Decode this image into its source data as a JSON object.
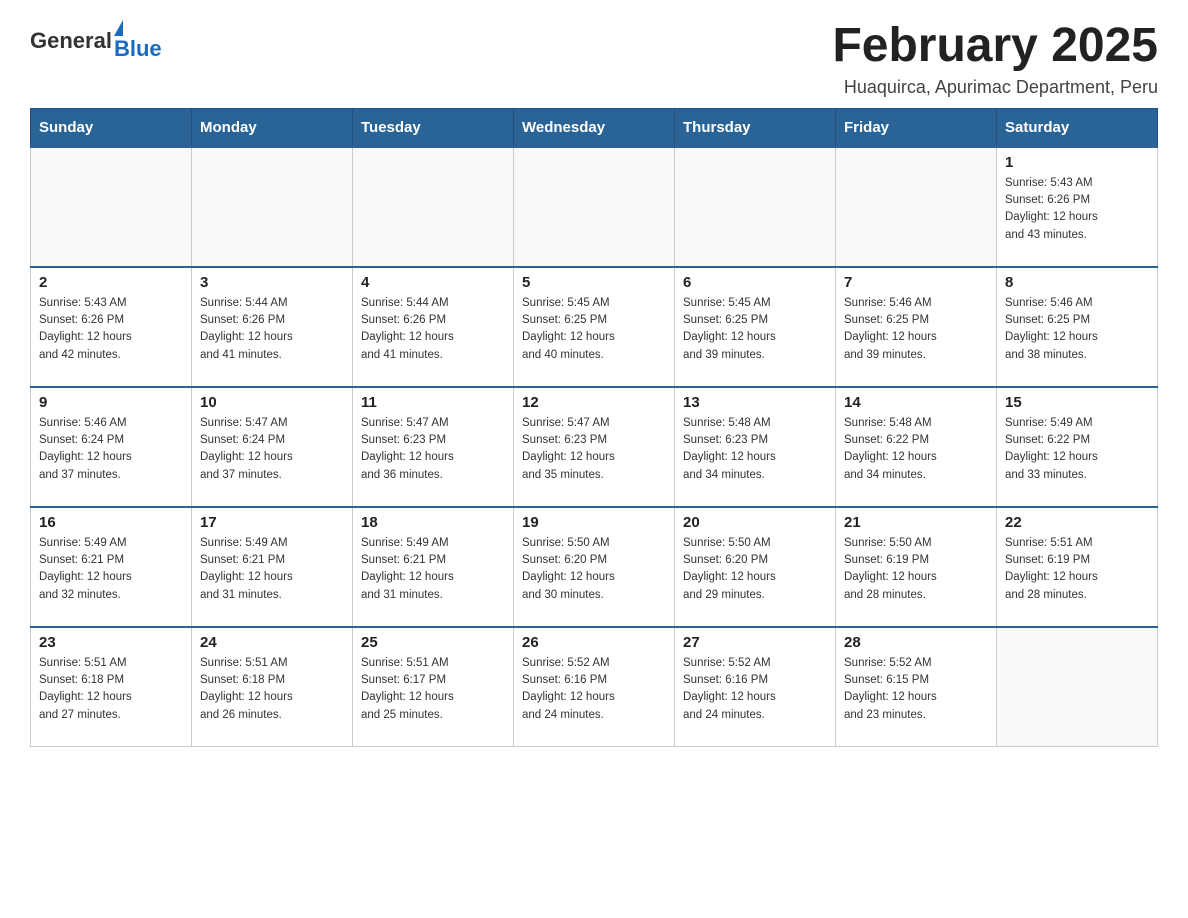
{
  "header": {
    "logo_general": "General",
    "logo_blue": "Blue",
    "month_title": "February 2025",
    "location": "Huaquirca, Apurimac Department, Peru"
  },
  "days_of_week": [
    "Sunday",
    "Monday",
    "Tuesday",
    "Wednesday",
    "Thursday",
    "Friday",
    "Saturday"
  ],
  "weeks": [
    [
      {
        "day": "",
        "info": ""
      },
      {
        "day": "",
        "info": ""
      },
      {
        "day": "",
        "info": ""
      },
      {
        "day": "",
        "info": ""
      },
      {
        "day": "",
        "info": ""
      },
      {
        "day": "",
        "info": ""
      },
      {
        "day": "1",
        "info": "Sunrise: 5:43 AM\nSunset: 6:26 PM\nDaylight: 12 hours\nand 43 minutes."
      }
    ],
    [
      {
        "day": "2",
        "info": "Sunrise: 5:43 AM\nSunset: 6:26 PM\nDaylight: 12 hours\nand 42 minutes."
      },
      {
        "day": "3",
        "info": "Sunrise: 5:44 AM\nSunset: 6:26 PM\nDaylight: 12 hours\nand 41 minutes."
      },
      {
        "day": "4",
        "info": "Sunrise: 5:44 AM\nSunset: 6:26 PM\nDaylight: 12 hours\nand 41 minutes."
      },
      {
        "day": "5",
        "info": "Sunrise: 5:45 AM\nSunset: 6:25 PM\nDaylight: 12 hours\nand 40 minutes."
      },
      {
        "day": "6",
        "info": "Sunrise: 5:45 AM\nSunset: 6:25 PM\nDaylight: 12 hours\nand 39 minutes."
      },
      {
        "day": "7",
        "info": "Sunrise: 5:46 AM\nSunset: 6:25 PM\nDaylight: 12 hours\nand 39 minutes."
      },
      {
        "day": "8",
        "info": "Sunrise: 5:46 AM\nSunset: 6:25 PM\nDaylight: 12 hours\nand 38 minutes."
      }
    ],
    [
      {
        "day": "9",
        "info": "Sunrise: 5:46 AM\nSunset: 6:24 PM\nDaylight: 12 hours\nand 37 minutes."
      },
      {
        "day": "10",
        "info": "Sunrise: 5:47 AM\nSunset: 6:24 PM\nDaylight: 12 hours\nand 37 minutes."
      },
      {
        "day": "11",
        "info": "Sunrise: 5:47 AM\nSunset: 6:23 PM\nDaylight: 12 hours\nand 36 minutes."
      },
      {
        "day": "12",
        "info": "Sunrise: 5:47 AM\nSunset: 6:23 PM\nDaylight: 12 hours\nand 35 minutes."
      },
      {
        "day": "13",
        "info": "Sunrise: 5:48 AM\nSunset: 6:23 PM\nDaylight: 12 hours\nand 34 minutes."
      },
      {
        "day": "14",
        "info": "Sunrise: 5:48 AM\nSunset: 6:22 PM\nDaylight: 12 hours\nand 34 minutes."
      },
      {
        "day": "15",
        "info": "Sunrise: 5:49 AM\nSunset: 6:22 PM\nDaylight: 12 hours\nand 33 minutes."
      }
    ],
    [
      {
        "day": "16",
        "info": "Sunrise: 5:49 AM\nSunset: 6:21 PM\nDaylight: 12 hours\nand 32 minutes."
      },
      {
        "day": "17",
        "info": "Sunrise: 5:49 AM\nSunset: 6:21 PM\nDaylight: 12 hours\nand 31 minutes."
      },
      {
        "day": "18",
        "info": "Sunrise: 5:49 AM\nSunset: 6:21 PM\nDaylight: 12 hours\nand 31 minutes."
      },
      {
        "day": "19",
        "info": "Sunrise: 5:50 AM\nSunset: 6:20 PM\nDaylight: 12 hours\nand 30 minutes."
      },
      {
        "day": "20",
        "info": "Sunrise: 5:50 AM\nSunset: 6:20 PM\nDaylight: 12 hours\nand 29 minutes."
      },
      {
        "day": "21",
        "info": "Sunrise: 5:50 AM\nSunset: 6:19 PM\nDaylight: 12 hours\nand 28 minutes."
      },
      {
        "day": "22",
        "info": "Sunrise: 5:51 AM\nSunset: 6:19 PM\nDaylight: 12 hours\nand 28 minutes."
      }
    ],
    [
      {
        "day": "23",
        "info": "Sunrise: 5:51 AM\nSunset: 6:18 PM\nDaylight: 12 hours\nand 27 minutes."
      },
      {
        "day": "24",
        "info": "Sunrise: 5:51 AM\nSunset: 6:18 PM\nDaylight: 12 hours\nand 26 minutes."
      },
      {
        "day": "25",
        "info": "Sunrise: 5:51 AM\nSunset: 6:17 PM\nDaylight: 12 hours\nand 25 minutes."
      },
      {
        "day": "26",
        "info": "Sunrise: 5:52 AM\nSunset: 6:16 PM\nDaylight: 12 hours\nand 24 minutes."
      },
      {
        "day": "27",
        "info": "Sunrise: 5:52 AM\nSunset: 6:16 PM\nDaylight: 12 hours\nand 24 minutes."
      },
      {
        "day": "28",
        "info": "Sunrise: 5:52 AM\nSunset: 6:15 PM\nDaylight: 12 hours\nand 23 minutes."
      },
      {
        "day": "",
        "info": ""
      }
    ]
  ]
}
